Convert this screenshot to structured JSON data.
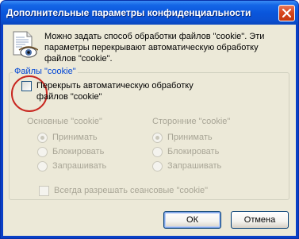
{
  "window": {
    "title": "Дополнительные параметры конфиденциальности"
  },
  "intro_text": "Можно задать способ обработки файлов \"cookie\". Эти параметры перекрывают автоматическую обработку файлов \"cookie\".",
  "group": {
    "legend": "Файлы \"cookie\"",
    "override_label": "Перекрыть автоматическую обработку файлов \"cookie\"",
    "override_checked": false,
    "first_party": {
      "title": "Основные \"cookie\"",
      "options": [
        "Принимать",
        "Блокировать",
        "Запрашивать"
      ],
      "selected": "Принимать"
    },
    "third_party": {
      "title": "Сторонние \"cookie\"",
      "options": [
        "Принимать",
        "Блокировать",
        "Запрашивать"
      ],
      "selected": "Принимать"
    },
    "session_label": "Всегда разрешать сеансовые \"cookie\"",
    "session_checked": false
  },
  "buttons": {
    "ok": "ОК",
    "cancel": "Отмена"
  },
  "colors": {
    "titlebar": "#0a56dc",
    "legend_text": "#0046d5",
    "disabled_text": "#a8a596",
    "highlight_circle": "#c8261f"
  }
}
